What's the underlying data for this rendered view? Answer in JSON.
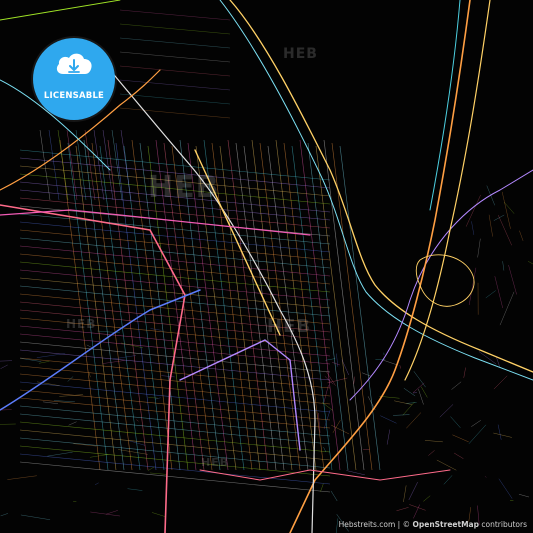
{
  "badge": {
    "label": "LICENSABLE",
    "icon": "cloud-download-icon",
    "color": "#2fa8ee"
  },
  "watermarks": [
    "HEB",
    "HEB",
    "HEB",
    "HEB",
    "HEB"
  ],
  "attribution": {
    "site": "Hebstreits.com",
    "separator": " | © ",
    "osm": "OpenStreetMap",
    "suffix": " contributors"
  },
  "palette": [
    "#ff6b8a",
    "#ffd166",
    "#7bdff2",
    "#b388ff",
    "#ff9f43",
    "#4dd0e1",
    "#f15bb5",
    "#a0e426",
    "#5c7cfa",
    "#e0e0e0"
  ]
}
